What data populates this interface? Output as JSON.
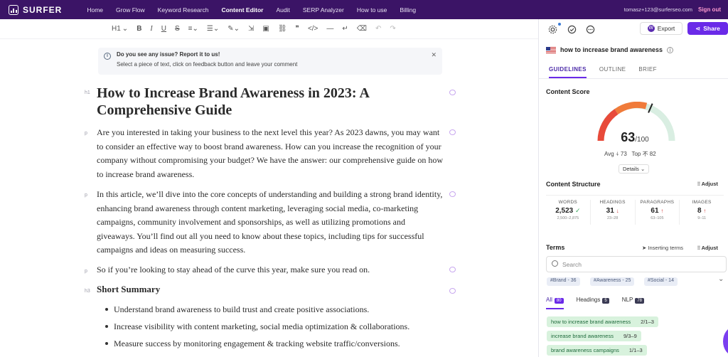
{
  "nav": {
    "logo": "SURFER",
    "links": [
      "Home",
      "Grow Flow",
      "Keyword Research",
      "Content Editor",
      "Audit",
      "SERP Analyzer",
      "How to use",
      "Billing"
    ],
    "active": "Content Editor",
    "user_email": "tomasz+123@surferseo.com",
    "signout": "Sign out"
  },
  "toolbar": {
    "heading_select": "H1"
  },
  "feedback": {
    "title": "Do you see any issue? Report it to us!",
    "text": "Select a piece of text, click on feedback button and leave your comment"
  },
  "doc": {
    "h1_tag": "h1",
    "h1": "How to Increase Brand Awareness in 2023: A Comprehensive Guide",
    "p_tag": "p",
    "p1": "Are you interested in taking your business to the next level this year? As 2023 dawns, you may want to consider an effective way to boost brand awareness. How can you increase the recognition of your company without compromising your budget? We have the answer: our comprehensive guide on how to increase brand awareness.",
    "p2": "In this article, we’ll dive into the core concepts of understanding and building a strong brand identity, enhancing brand awareness through content marketing, leveraging social media, co-marketing campaigns, community involvement and sponsorships, as well as utilizing promotions and giveaways. You’ll find out all you need to know about these topics, including tips for successful campaigns and ideas on measuring success.",
    "p3": "So if you’re looking to stay ahead of the curve this year, make sure you read on.",
    "h3_tag": "h3",
    "h3": "Short Summary",
    "bullets": [
      "Understand brand awareness to build trust and create positive associations.",
      "Increase visibility with content marketing, social media optimization & collaborations.",
      "Measure success by monitoring engagement & tracking website traffic/conversions."
    ]
  },
  "panel": {
    "export": "Export",
    "share": "Share",
    "keyword": "how to increase brand awareness",
    "tabs": [
      "GUIDELINES",
      "OUTLINE",
      "BRIEF"
    ],
    "content_score_title": "Content Score",
    "score": "63",
    "score_max": "/100",
    "score_fraction": 0.63,
    "avg": "Avg ⍭ 73",
    "top": "Top 不 82",
    "details": "Details",
    "structure_title": "Content Structure",
    "adjust": "Adjust",
    "stats": [
      {
        "label": "WORDS",
        "value": "2,523",
        "mark": "✓",
        "range": "2,500–2,875"
      },
      {
        "label": "HEADINGS",
        "value": "31",
        "mark": "↓",
        "range": "23–28"
      },
      {
        "label": "PARAGRAPHS",
        "value": "61",
        "mark": "↑",
        "range": "63–105"
      },
      {
        "label": "IMAGES",
        "value": "8",
        "mark": "↑",
        "range": "9–11"
      }
    ],
    "terms_title": "Terms",
    "inserting_terms": "Inserting terms",
    "search_placeholder": "Search",
    "chips": [
      "#Brand - 36",
      "#Awareness - 25",
      "#Social - 14"
    ],
    "filter_tabs": [
      {
        "label": "All",
        "badge": "80"
      },
      {
        "label": "Headings",
        "badge": "5"
      },
      {
        "label": "NLP",
        "badge": "78"
      }
    ],
    "terms": [
      {
        "term": "how to increase brand awareness",
        "count": "2/1–3"
      },
      {
        "term": "increase brand awareness",
        "count": "9/3–9"
      },
      {
        "term": "brand awareness campaigns",
        "count": "1/1–3"
      }
    ],
    "colors": {
      "accent": "#6a2ae8",
      "nav": "#3b1466",
      "term_bg": "#d8f2dd"
    }
  }
}
